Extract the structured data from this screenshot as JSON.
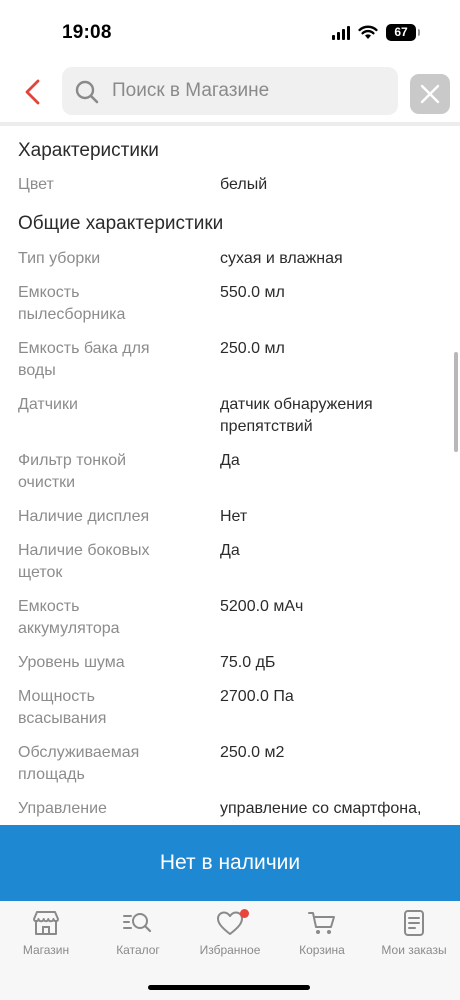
{
  "status_bar": {
    "time": "19:08",
    "battery": "67"
  },
  "search": {
    "placeholder": "Поиск в Магазине",
    "value": ""
  },
  "specs": {
    "section1_title": "Характеристики",
    "color_label": "Цвет",
    "color_value": "белый",
    "section2_title": "Общие характеристики",
    "rows": [
      {
        "label": "Тип уборки",
        "value": "сухая и влажная"
      },
      {
        "label": "Емкость пылесборника",
        "value": "550.0 мл"
      },
      {
        "label": "Емкость бака для воды",
        "value": "250.0 мл"
      },
      {
        "label": "Датчики",
        "value": "датчик обнаружения препятствий"
      },
      {
        "label": "Фильтр тонкой очистки",
        "value": "Да"
      },
      {
        "label": "Наличие дисплея",
        "value": "Нет"
      },
      {
        "label": "Наличие боковых щеток",
        "value": "Да"
      },
      {
        "label": "Емкость аккумулятора",
        "value": "5200.0 мАч"
      },
      {
        "label": "Уровень шума",
        "value": "75.0 дБ"
      },
      {
        "label": "Мощность всасывания",
        "value": "2700.0 Па"
      },
      {
        "label": "Обслуживаемая площадь",
        "value": "250.0 м2"
      },
      {
        "label": "Управление",
        "value": "управление со смартфона,"
      }
    ]
  },
  "action": {
    "label": "Нет в наличии"
  },
  "tabs": [
    {
      "label": "Магазин",
      "icon": "store-icon"
    },
    {
      "label": "Каталог",
      "icon": "catalog-search-icon"
    },
    {
      "label": "Избранное",
      "icon": "heart-icon"
    },
    {
      "label": "Корзина",
      "icon": "cart-icon"
    },
    {
      "label": "Мои заказы",
      "icon": "orders-icon"
    }
  ],
  "colors": {
    "accent": "#1e88d2",
    "back_arrow": "#e0453a",
    "badge": "#e8453c",
    "label_gray": "#8c8c8c"
  }
}
